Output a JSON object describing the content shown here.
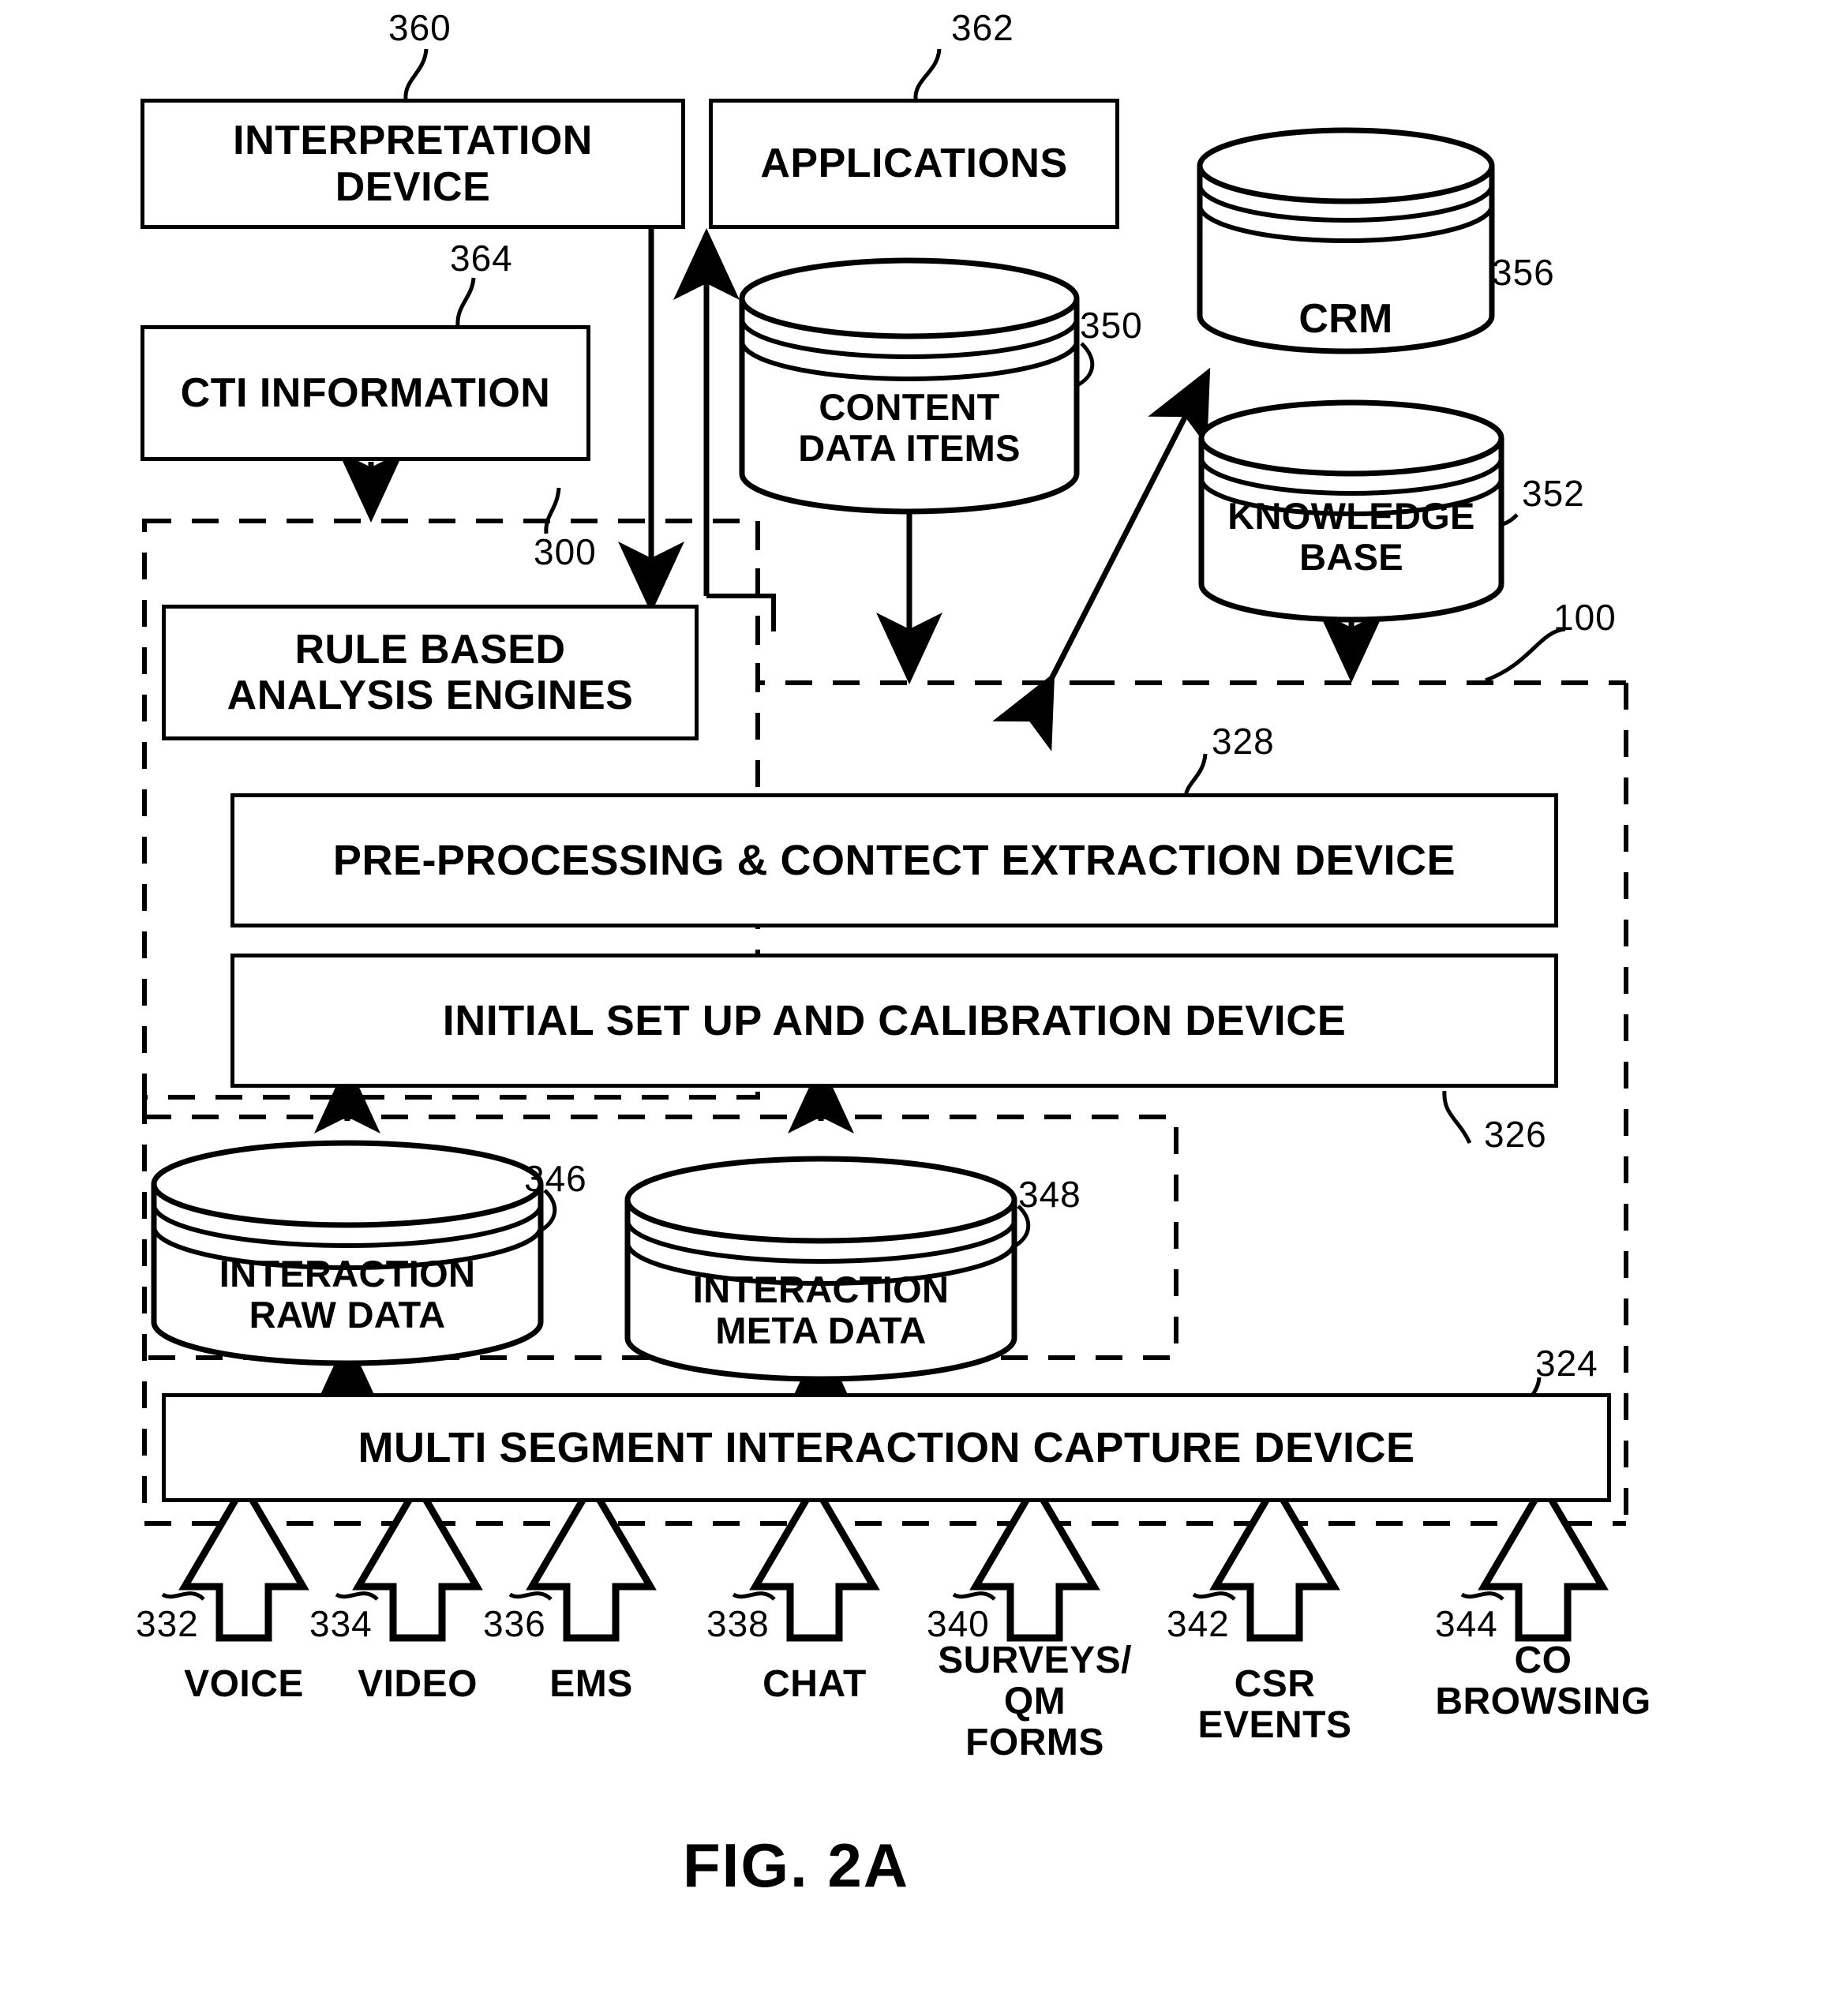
{
  "figure": {
    "caption": "FIG. 2A"
  },
  "boxes": {
    "interpretation_device": {
      "label": "INTERPRETATION\nDEVICE",
      "ref": "360"
    },
    "applications": {
      "label": "APPLICATIONS",
      "ref": "362"
    },
    "cti_information": {
      "label": "CTI INFORMATION",
      "ref": "364"
    },
    "rule_based_analysis_engines": {
      "label": "RULE BASED\nANALYSIS ENGINES",
      "ref": "300"
    },
    "pre_processing": {
      "label": "PRE-PROCESSING & CONTECT EXTRACTION DEVICE",
      "ref": "328"
    },
    "initial_setup": {
      "label": "INITIAL SET UP AND CALIBRATION DEVICE",
      "ref": "326"
    },
    "multi_segment_capture": {
      "label": "MULTI SEGMENT INTERACTION CAPTURE DEVICE",
      "ref": "324"
    }
  },
  "datastores": {
    "content_data_items": {
      "label": "CONTENT\nDATA ITEMS",
      "ref": "350"
    },
    "crm": {
      "label": "CRM",
      "ref": "356"
    },
    "knowledge_base": {
      "label": "KNOWLEDGE\nBASE",
      "ref": "352"
    },
    "interaction_raw_data": {
      "label": "INTERACTION\nRAW DATA",
      "ref": "346"
    },
    "interaction_meta_data": {
      "label": "INTERACTION\nMETA DATA",
      "ref": "348"
    }
  },
  "regions": {
    "system_boundary": {
      "ref": "100"
    }
  },
  "channels": [
    {
      "label": "VOICE",
      "ref": "332"
    },
    {
      "label": "VIDEO",
      "ref": "334"
    },
    {
      "label": "EMS",
      "ref": "336"
    },
    {
      "label": "CHAT",
      "ref": "338"
    },
    {
      "label": "SURVEYS/\nQM\nFORMS",
      "ref": "340"
    },
    {
      "label": "CSR\nEVENTS",
      "ref": "342"
    },
    {
      "label": "CO\nBROWSING",
      "ref": "344"
    }
  ],
  "colors": {
    "ink": "#000000",
    "paper": "#ffffff"
  }
}
